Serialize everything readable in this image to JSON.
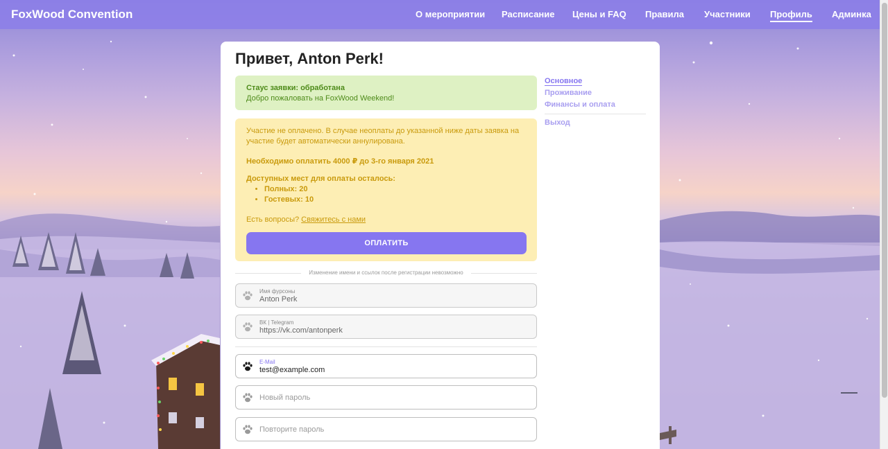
{
  "header": {
    "brand": "FoxWood Convention",
    "nav": [
      {
        "label": "О мероприятии"
      },
      {
        "label": "Расписание"
      },
      {
        "label": "Цены и FAQ"
      },
      {
        "label": "Правила"
      },
      {
        "label": "Участники"
      },
      {
        "label": "Профиль",
        "active": true
      },
      {
        "label": "Админка"
      }
    ]
  },
  "profile": {
    "greeting": "Привет, Anton Perk!",
    "status": {
      "title": "Стаус заявки: обработана",
      "message": "Добро пожаловать на FoxWood Weekend!"
    },
    "payment": {
      "warning": "Участие не оплачено. В случае неоплаты до указанной ниже даты заявка на участие будет автоматически аннулирована.",
      "due": "Необходимо оплатить 4000 ₽ до 3-го января 2021",
      "places_title": "Доступных мест для оплаты осталось:",
      "places": [
        "Полных: 20",
        "Гостевых: 10"
      ],
      "question": "Есть вопросы?",
      "contact_link": "Свяжитесь с нами",
      "pay_button": "ОПЛАТИТЬ"
    },
    "note": "Изменение имени и ссылок после регистрации невозможно",
    "fields": {
      "name": {
        "label": "Имя фурсоны",
        "value": "Anton Perk"
      },
      "link": {
        "label": "ВК | Telegram",
        "value": "https://vk.com/antonperk"
      },
      "email": {
        "label": "E-Mail",
        "value": "test@example.com"
      },
      "new_password": {
        "placeholder": "Новый пароль"
      },
      "repeat_password": {
        "placeholder": "Повторите пароль"
      }
    }
  },
  "side_nav": {
    "items": [
      {
        "label": "Основное",
        "active": true
      },
      {
        "label": "Проживание"
      },
      {
        "label": "Финансы и оплата"
      }
    ],
    "logout": "Выход"
  },
  "colors": {
    "accent": "#8676f0",
    "header": "#8c7ee8",
    "success_bg": "#def1c3",
    "success_text": "#4e8b1a",
    "warning_bg": "#fdeeb4",
    "warning_text": "#c99a0c"
  }
}
